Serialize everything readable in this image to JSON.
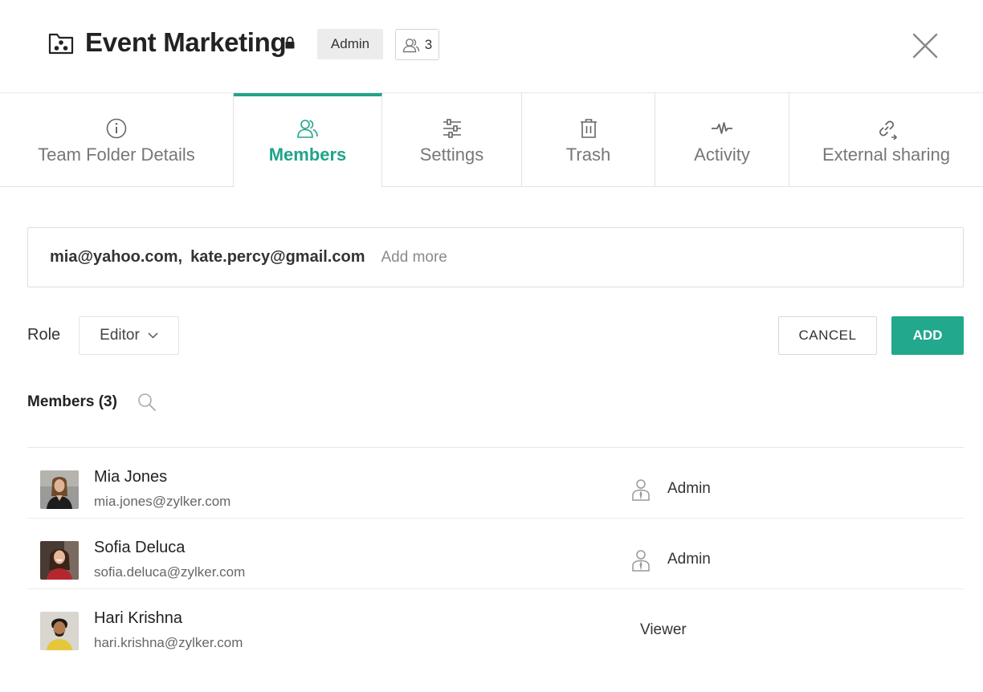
{
  "header": {
    "title": "Event Marketing",
    "role_badge": "Admin",
    "member_count": "3"
  },
  "tabs": [
    {
      "label": "Team Folder Details",
      "icon": "info-icon",
      "active": false
    },
    {
      "label": "Members",
      "icon": "members-icon",
      "active": true
    },
    {
      "label": "Settings",
      "icon": "sliders-icon",
      "active": false
    },
    {
      "label": "Trash",
      "icon": "trash-icon",
      "active": false
    },
    {
      "label": "Activity",
      "icon": "pulse-icon",
      "active": false
    },
    {
      "label": "External sharing",
      "icon": "link-icon",
      "active": false
    }
  ],
  "invite": {
    "emails": [
      "mia@yahoo.com",
      "kate.percy@gmail.com"
    ],
    "placeholder": "Add more"
  },
  "role_row": {
    "label": "Role",
    "selected": "Editor",
    "cancel_label": "CANCEL",
    "add_label": "ADD"
  },
  "members": {
    "heading": "Members (3)",
    "items": [
      {
        "name": "Mia Jones",
        "email": "mia.jones@zylker.com",
        "role": "Admin"
      },
      {
        "name": "Sofia Deluca",
        "email": "sofia.deluca@zylker.com",
        "role": "Admin"
      },
      {
        "name": "Hari Krishna",
        "email": "hari.krishna@zylker.com",
        "role": "Viewer"
      }
    ]
  },
  "colors": {
    "accent": "#22a88c",
    "muted": "#777777"
  }
}
